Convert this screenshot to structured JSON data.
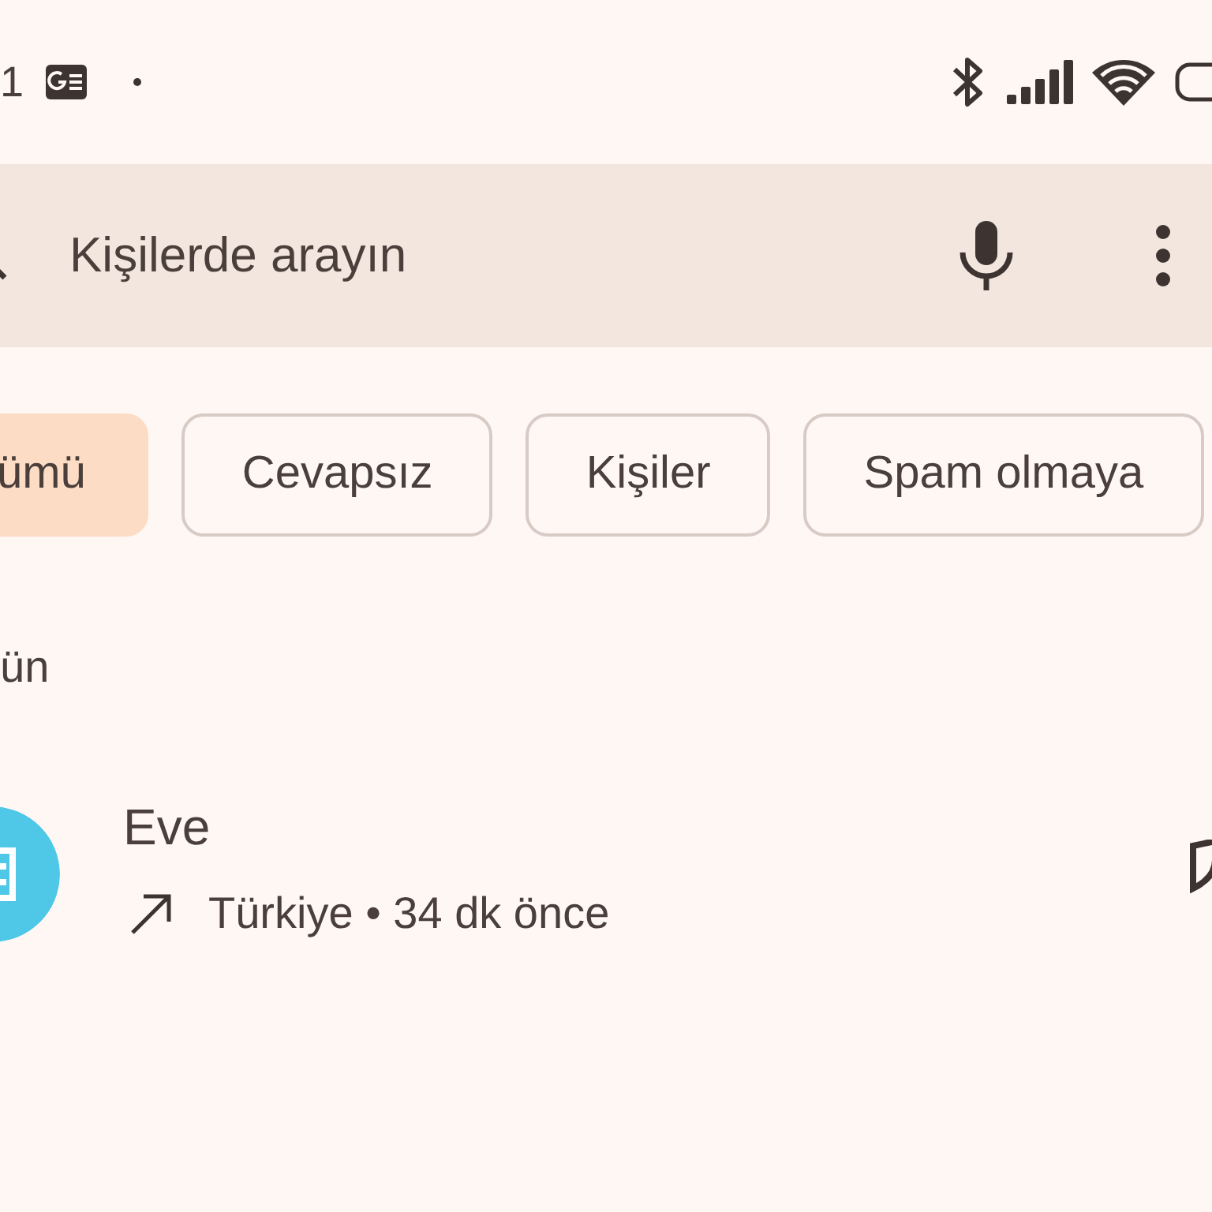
{
  "status_bar": {
    "time": "1"
  },
  "search": {
    "placeholder": "Kişilerde arayın"
  },
  "filters": [
    {
      "label": "ümü",
      "selected": true
    },
    {
      "label": "Cevapsız",
      "selected": false
    },
    {
      "label": "Kişiler",
      "selected": false
    },
    {
      "label": "Spam olmaya",
      "selected": false
    }
  ],
  "section_header": "ün",
  "calls": [
    {
      "name": "Eve",
      "kind": "outgoing",
      "detail": "Türkiye • 34 dk önce",
      "color": "#4fc8e8"
    }
  ]
}
